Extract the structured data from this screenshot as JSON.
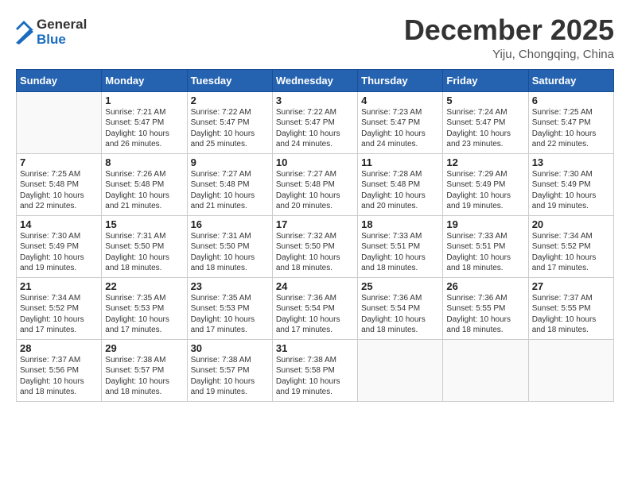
{
  "header": {
    "logo_general": "General",
    "logo_blue": "Blue",
    "month_title": "December 2025",
    "subtitle": "Yiju, Chongqing, China"
  },
  "days_of_week": [
    "Sunday",
    "Monday",
    "Tuesday",
    "Wednesday",
    "Thursday",
    "Friday",
    "Saturday"
  ],
  "weeks": [
    [
      {
        "day": "",
        "info": ""
      },
      {
        "day": "1",
        "info": "Sunrise: 7:21 AM\nSunset: 5:47 PM\nDaylight: 10 hours\nand 26 minutes."
      },
      {
        "day": "2",
        "info": "Sunrise: 7:22 AM\nSunset: 5:47 PM\nDaylight: 10 hours\nand 25 minutes."
      },
      {
        "day": "3",
        "info": "Sunrise: 7:22 AM\nSunset: 5:47 PM\nDaylight: 10 hours\nand 24 minutes."
      },
      {
        "day": "4",
        "info": "Sunrise: 7:23 AM\nSunset: 5:47 PM\nDaylight: 10 hours\nand 24 minutes."
      },
      {
        "day": "5",
        "info": "Sunrise: 7:24 AM\nSunset: 5:47 PM\nDaylight: 10 hours\nand 23 minutes."
      },
      {
        "day": "6",
        "info": "Sunrise: 7:25 AM\nSunset: 5:47 PM\nDaylight: 10 hours\nand 22 minutes."
      }
    ],
    [
      {
        "day": "7",
        "info": "Sunrise: 7:25 AM\nSunset: 5:48 PM\nDaylight: 10 hours\nand 22 minutes."
      },
      {
        "day": "8",
        "info": "Sunrise: 7:26 AM\nSunset: 5:48 PM\nDaylight: 10 hours\nand 21 minutes."
      },
      {
        "day": "9",
        "info": "Sunrise: 7:27 AM\nSunset: 5:48 PM\nDaylight: 10 hours\nand 21 minutes."
      },
      {
        "day": "10",
        "info": "Sunrise: 7:27 AM\nSunset: 5:48 PM\nDaylight: 10 hours\nand 20 minutes."
      },
      {
        "day": "11",
        "info": "Sunrise: 7:28 AM\nSunset: 5:48 PM\nDaylight: 10 hours\nand 20 minutes."
      },
      {
        "day": "12",
        "info": "Sunrise: 7:29 AM\nSunset: 5:49 PM\nDaylight: 10 hours\nand 19 minutes."
      },
      {
        "day": "13",
        "info": "Sunrise: 7:30 AM\nSunset: 5:49 PM\nDaylight: 10 hours\nand 19 minutes."
      }
    ],
    [
      {
        "day": "14",
        "info": "Sunrise: 7:30 AM\nSunset: 5:49 PM\nDaylight: 10 hours\nand 19 minutes."
      },
      {
        "day": "15",
        "info": "Sunrise: 7:31 AM\nSunset: 5:50 PM\nDaylight: 10 hours\nand 18 minutes."
      },
      {
        "day": "16",
        "info": "Sunrise: 7:31 AM\nSunset: 5:50 PM\nDaylight: 10 hours\nand 18 minutes."
      },
      {
        "day": "17",
        "info": "Sunrise: 7:32 AM\nSunset: 5:50 PM\nDaylight: 10 hours\nand 18 minutes."
      },
      {
        "day": "18",
        "info": "Sunrise: 7:33 AM\nSunset: 5:51 PM\nDaylight: 10 hours\nand 18 minutes."
      },
      {
        "day": "19",
        "info": "Sunrise: 7:33 AM\nSunset: 5:51 PM\nDaylight: 10 hours\nand 18 minutes."
      },
      {
        "day": "20",
        "info": "Sunrise: 7:34 AM\nSunset: 5:52 PM\nDaylight: 10 hours\nand 17 minutes."
      }
    ],
    [
      {
        "day": "21",
        "info": "Sunrise: 7:34 AM\nSunset: 5:52 PM\nDaylight: 10 hours\nand 17 minutes."
      },
      {
        "day": "22",
        "info": "Sunrise: 7:35 AM\nSunset: 5:53 PM\nDaylight: 10 hours\nand 17 minutes."
      },
      {
        "day": "23",
        "info": "Sunrise: 7:35 AM\nSunset: 5:53 PM\nDaylight: 10 hours\nand 17 minutes."
      },
      {
        "day": "24",
        "info": "Sunrise: 7:36 AM\nSunset: 5:54 PM\nDaylight: 10 hours\nand 17 minutes."
      },
      {
        "day": "25",
        "info": "Sunrise: 7:36 AM\nSunset: 5:54 PM\nDaylight: 10 hours\nand 18 minutes."
      },
      {
        "day": "26",
        "info": "Sunrise: 7:36 AM\nSunset: 5:55 PM\nDaylight: 10 hours\nand 18 minutes."
      },
      {
        "day": "27",
        "info": "Sunrise: 7:37 AM\nSunset: 5:55 PM\nDaylight: 10 hours\nand 18 minutes."
      }
    ],
    [
      {
        "day": "28",
        "info": "Sunrise: 7:37 AM\nSunset: 5:56 PM\nDaylight: 10 hours\nand 18 minutes."
      },
      {
        "day": "29",
        "info": "Sunrise: 7:38 AM\nSunset: 5:57 PM\nDaylight: 10 hours\nand 18 minutes."
      },
      {
        "day": "30",
        "info": "Sunrise: 7:38 AM\nSunset: 5:57 PM\nDaylight: 10 hours\nand 19 minutes."
      },
      {
        "day": "31",
        "info": "Sunrise: 7:38 AM\nSunset: 5:58 PM\nDaylight: 10 hours\nand 19 minutes."
      },
      {
        "day": "",
        "info": ""
      },
      {
        "day": "",
        "info": ""
      },
      {
        "day": "",
        "info": ""
      }
    ]
  ]
}
